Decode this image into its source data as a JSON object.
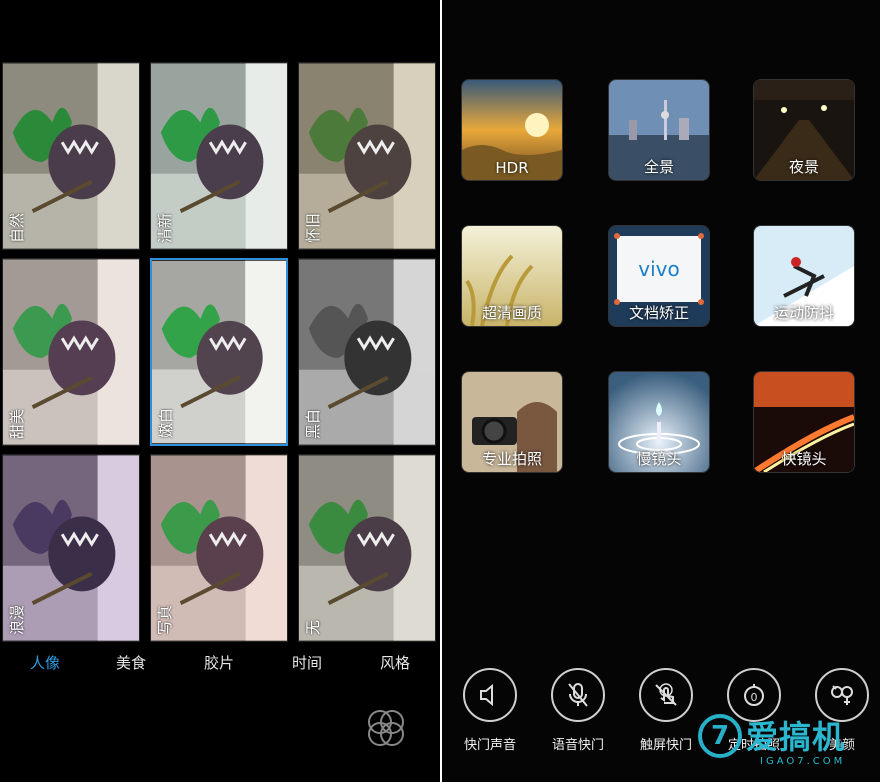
{
  "filters": [
    {
      "label": "自然",
      "tone": "natural"
    },
    {
      "label": "清新",
      "tone": "fresh"
    },
    {
      "label": "怀旧",
      "tone": "nostalgic"
    },
    {
      "label": "甜美",
      "tone": "sweet"
    },
    {
      "label": "嫩白",
      "tone": "white",
      "selected": true
    },
    {
      "label": "黑白",
      "tone": "mono"
    },
    {
      "label": "浪漫",
      "tone": "purple"
    },
    {
      "label": "写真",
      "tone": "portrait"
    },
    {
      "label": "无",
      "tone": "none"
    }
  ],
  "tabs": [
    {
      "label": "人像",
      "active": true
    },
    {
      "label": "美食"
    },
    {
      "label": "胶片"
    },
    {
      "label": "时间"
    },
    {
      "label": "风格"
    }
  ],
  "modes": [
    {
      "label": "HDR",
      "scene": "sunset-field"
    },
    {
      "label": "全景",
      "scene": "city-skyline"
    },
    {
      "label": "夜景",
      "scene": "night-street"
    },
    {
      "label": "超清画质",
      "scene": "wheat"
    },
    {
      "label": "文档矫正",
      "scene": "document"
    },
    {
      "label": "运动防抖",
      "scene": "ski"
    },
    {
      "label": "专业拍照",
      "scene": "camera"
    },
    {
      "label": "慢镜头",
      "scene": "water-drop"
    },
    {
      "label": "快镜头",
      "scene": "light-trails"
    }
  ],
  "document_logo_text": "vivo",
  "controls": [
    {
      "label": "快门声音",
      "icon": "speaker-icon"
    },
    {
      "label": "语音快门",
      "icon": "microphone-icon"
    },
    {
      "label": "触屏快门",
      "icon": "touch-icon"
    },
    {
      "label": "定时拍照",
      "icon": "timer-icon"
    },
    {
      "label": "美颜",
      "icon": "gender-icon"
    }
  ],
  "watermark": {
    "mark": "7",
    "text": "爱搞机",
    "sub": "IGAO7.COM"
  },
  "colors": {
    "accent": "#2f9be0",
    "watermark": "#2bb7cf"
  }
}
